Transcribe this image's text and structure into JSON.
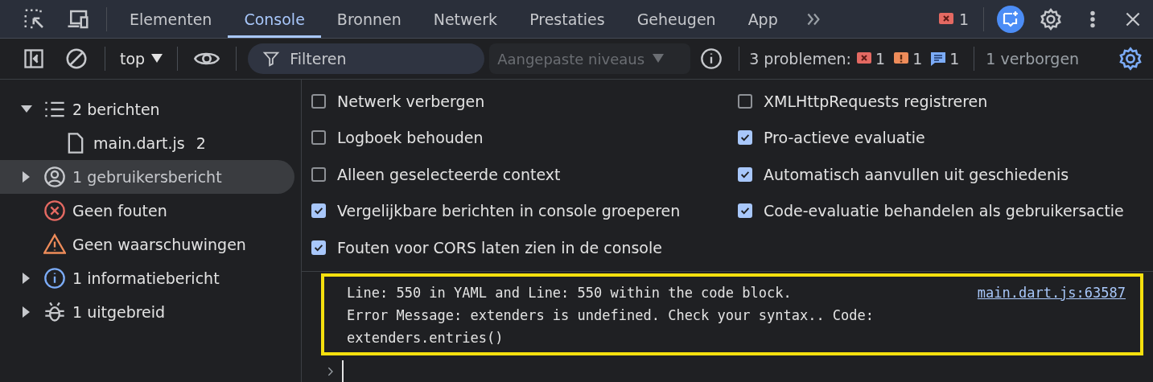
{
  "main_tabs": [
    {
      "label": "Elementen",
      "selected": false
    },
    {
      "label": "Console",
      "selected": true
    },
    {
      "label": "Bronnen",
      "selected": false
    },
    {
      "label": "Netwerk",
      "selected": false
    },
    {
      "label": "Prestaties",
      "selected": false
    },
    {
      "label": "Geheugen",
      "selected": false
    },
    {
      "label": "App",
      "selected": false
    }
  ],
  "error_badge": {
    "count": "1"
  },
  "console_toolbar": {
    "context": "top",
    "filter": {
      "placeholder": "Filteren"
    },
    "levels": {
      "label": "Aangepaste niveaus",
      "disabled": true
    },
    "issues_label": "3 problemen:",
    "issues": [
      {
        "kind": "error",
        "count": "1"
      },
      {
        "kind": "warning",
        "count": "1"
      },
      {
        "kind": "info",
        "count": "1"
      }
    ],
    "hidden": "1 verborgen"
  },
  "sidebar": {
    "items": [
      {
        "kind": "messages",
        "label": "2 berichten",
        "expanded": true,
        "selected": false,
        "children": [
          {
            "kind": "file",
            "label": "main.dart.js",
            "count": "2",
            "selected": false
          }
        ]
      },
      {
        "kind": "user",
        "label": "1 gebruikersbericht",
        "expanded": false,
        "selected": true
      },
      {
        "kind": "error",
        "label": "Geen fouten",
        "selected": false
      },
      {
        "kind": "warning",
        "label": "Geen waarschuwingen",
        "selected": false
      },
      {
        "kind": "info",
        "label": "1 informatiebericht",
        "expanded": false,
        "selected": false
      },
      {
        "kind": "verbose",
        "label": "1 uitgebreid",
        "expanded": false,
        "selected": false
      }
    ]
  },
  "settings": [
    {
      "label": "Netwerk verbergen",
      "checked": false
    },
    {
      "label": "XMLHttpRequests registreren",
      "checked": false
    },
    {
      "label": "Logboek behouden",
      "checked": false
    },
    {
      "label": "Pro-actieve evaluatie",
      "checked": true
    },
    {
      "label": "Alleen geselecteerde context",
      "checked": false
    },
    {
      "label": "Automatisch aanvullen uit geschiedenis",
      "checked": true
    },
    {
      "label": "Vergelijkbare berichten in console groeperen",
      "checked": true
    },
    {
      "label": "Code-evaluatie behandelen als gebruikersactie",
      "checked": true
    },
    {
      "label": "Fouten voor CORS laten zien in de console",
      "checked": true
    }
  ],
  "messages": [
    {
      "lines": [
        "Line: 550 in YAML and Line: 550 within the code block.",
        "Error Message: extenders is undefined. Check your syntax.. Code:",
        "extenders.entries()"
      ],
      "source": "main.dart.js:63587",
      "highlighted": true
    }
  ]
}
